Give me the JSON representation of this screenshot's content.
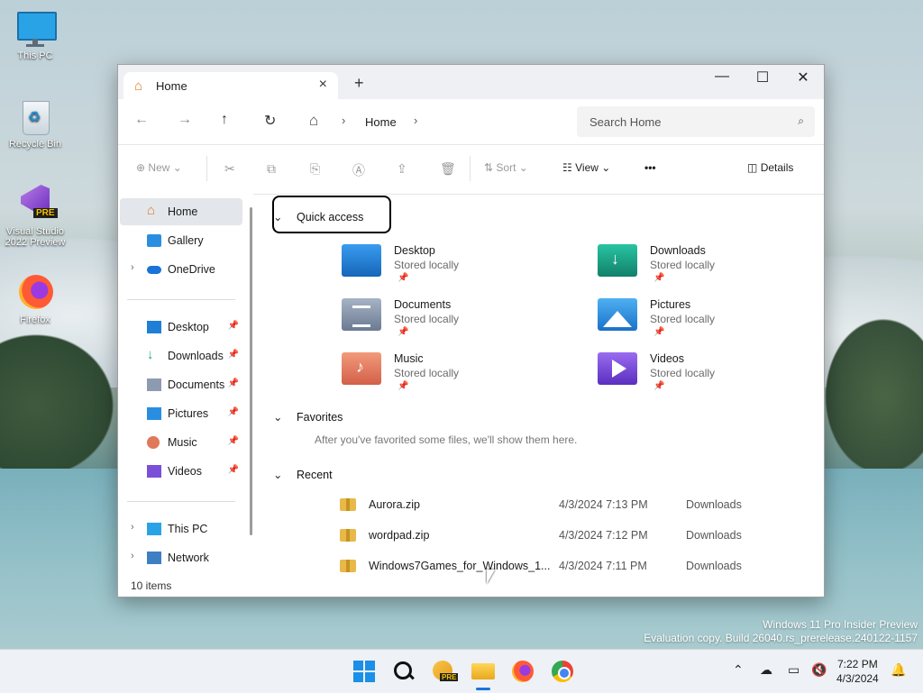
{
  "desktop": {
    "icons": [
      {
        "label": "This PC"
      },
      {
        "label": "Recycle Bin"
      },
      {
        "label": "Visual Studio 2022 Preview"
      },
      {
        "label": "Firefox"
      }
    ],
    "vs_badge": "PRE"
  },
  "window": {
    "tab_title": "Home",
    "new_tab": "+",
    "controls": {
      "minimize": "—",
      "maximize": "☐",
      "close": "✕"
    },
    "address": {
      "back": "←",
      "forward": "→",
      "up": "↑",
      "refresh": "↻",
      "crumb_home": "Home",
      "search_placeholder": "Search Home"
    },
    "commands": {
      "new": "New",
      "sort": "Sort",
      "view": "View",
      "more": "•••",
      "details": "Details"
    },
    "sidebar": {
      "top": [
        {
          "label": "Home"
        },
        {
          "label": "Gallery"
        },
        {
          "label": "OneDrive"
        }
      ],
      "pinned": [
        {
          "label": "Desktop"
        },
        {
          "label": "Downloads"
        },
        {
          "label": "Documents"
        },
        {
          "label": "Pictures"
        },
        {
          "label": "Music"
        },
        {
          "label": "Videos"
        }
      ],
      "bottom": [
        {
          "label": "This PC"
        },
        {
          "label": "Network"
        }
      ]
    },
    "quick_access": {
      "title": "Quick access",
      "items": [
        {
          "name": "Desktop",
          "status": "Stored locally",
          "color": "#1f7fd6"
        },
        {
          "name": "Downloads",
          "status": "Stored locally",
          "color": "#1aa58a"
        },
        {
          "name": "Documents",
          "status": "Stored locally",
          "color": "#7f8fa8"
        },
        {
          "name": "Pictures",
          "status": "Stored locally",
          "color": "#2a8ee0"
        },
        {
          "name": "Music",
          "status": "Stored locally",
          "color": "#e0785a"
        },
        {
          "name": "Videos",
          "status": "Stored locally",
          "color": "#7c4fd8"
        }
      ]
    },
    "favorites": {
      "title": "Favorites",
      "empty_text": "After you've favorited some files, we'll show them here."
    },
    "recent": {
      "title": "Recent",
      "rows": [
        {
          "name": "Aurora.zip",
          "date": "4/3/2024 7:13 PM",
          "location": "Downloads"
        },
        {
          "name": "wordpad.zip",
          "date": "4/3/2024 7:12 PM",
          "location": "Downloads"
        },
        {
          "name": "Windows7Games_for_Windows_1...",
          "date": "4/3/2024 7:11 PM",
          "location": "Downloads"
        }
      ]
    },
    "status": "10 items"
  },
  "watermark": {
    "line1": "Windows 11 Pro Insider Preview",
    "line2": "Evaluation copy. Build 26040.rs_prerelease.240122-1157"
  },
  "taskbar": {
    "time": "7:22 PM",
    "date": "4/3/2024",
    "pre_badge": "PRE"
  }
}
